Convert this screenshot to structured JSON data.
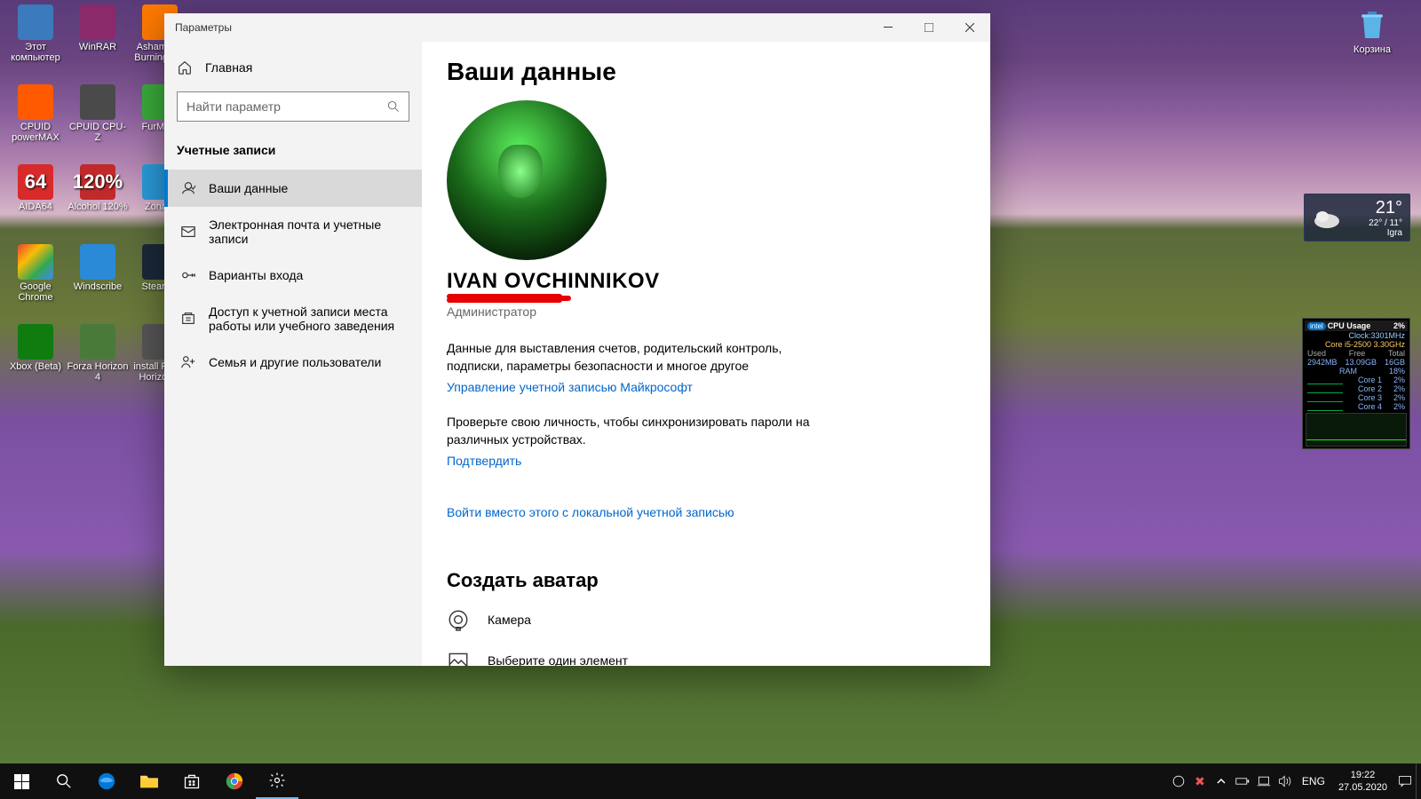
{
  "desktop": {
    "icons": [
      {
        "label": "Этот\nкомпьютер",
        "bg": "#3a7abd"
      },
      {
        "label": "WinRAR",
        "bg": "#8a2a6a"
      },
      {
        "label": "Ashampoo Burning S...",
        "bg": "#ff7a00"
      },
      {
        "label": "CPUID powerMAX",
        "bg": "#ff5a00"
      },
      {
        "label": "CPUID CPU-Z",
        "bg": "#4a4a4a"
      },
      {
        "label": "FurMa...",
        "bg": "#3aaa3a"
      },
      {
        "label": "AIDA64",
        "bg": "#d82a2a",
        "txt": "64"
      },
      {
        "label": "Alcohol 120%",
        "bg": "#c02a2a",
        "txt": "120%"
      },
      {
        "label": "Zona...",
        "bg": "#2a9ad8"
      },
      {
        "label": "Google Chrome",
        "bg": "linear-gradient(135deg,#ea4335,#fbbc05,#34a853,#4285f4)"
      },
      {
        "label": "Windscribe",
        "bg": "#2a8ad8"
      },
      {
        "label": "Steam...",
        "bg": "#1b2838"
      },
      {
        "label": "Xbox (Beta)",
        "bg": "#107c10"
      },
      {
        "label": "Forza Horizon 4",
        "bg": "#4a7a3a"
      },
      {
        "label": "install Forza Horizon...",
        "bg": "#555"
      }
    ],
    "recycle_label": "Корзина"
  },
  "weather": {
    "current": "21°",
    "range": "22° / 11°",
    "location": "Igra"
  },
  "cpu": {
    "title": "CPU Usage",
    "pct": "2%",
    "clock_label": "Clock:",
    "clock": "3301MHz",
    "cpu_model": "Core i5-2500 3.30GHz",
    "headers": [
      "Used",
      "Free",
      "Total"
    ],
    "mem": [
      "2942MB",
      "13.09GB",
      "16GB"
    ],
    "ram_label": "RAM",
    "ram_pct": "18%",
    "cores": [
      {
        "name": "Core 1",
        "pct": "2%"
      },
      {
        "name": "Core 2",
        "pct": "2%"
      },
      {
        "name": "Core 3",
        "pct": "2%"
      },
      {
        "name": "Core 4",
        "pct": "2%"
      }
    ]
  },
  "settings": {
    "window_title": "Параметры",
    "home": "Главная",
    "search_placeholder": "Найти параметр",
    "section": "Учетные записи",
    "nav": [
      {
        "label": "Ваши данные",
        "active": true
      },
      {
        "label": "Электронная почта и учетные записи",
        "active": false
      },
      {
        "label": "Варианты входа",
        "active": false
      },
      {
        "label": "Доступ к учетной записи места работы или учебного заведения",
        "active": false
      },
      {
        "label": "Семья и другие пользователи",
        "active": false
      }
    ],
    "page_title": "Ваши данные",
    "username": "IVAN OVCHINNIKOV",
    "role": "Администратор",
    "para1": "Данные для выставления счетов, родительский контроль, подписки, параметры безопасности и многое другое",
    "link_manage": "Управление учетной записью Майкрософт",
    "para2": "Проверьте свою личность, чтобы синхронизировать пароли на различных устройствах.",
    "link_verify": "Подтвердить",
    "link_local": "Войти вместо этого с локальной учетной записью",
    "create_avatar": "Создать аватар",
    "avatar_camera": "Камера",
    "avatar_browse": "Выберите один элемент"
  },
  "taskbar": {
    "lang": "ENG",
    "time": "19:22",
    "date": "27.05.2020"
  }
}
